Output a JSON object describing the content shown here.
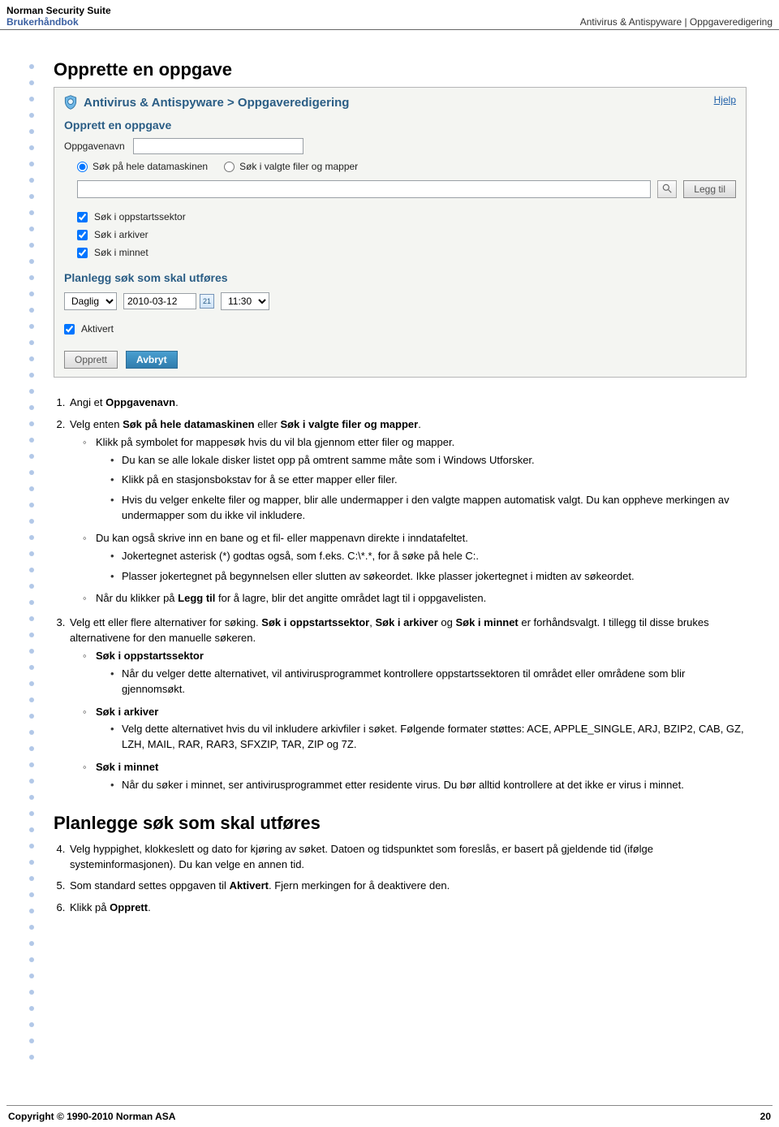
{
  "header": {
    "product": "Norman Security Suite",
    "doc": "Brukerhåndbok",
    "breadcrumb": "Antivirus & Antispyware | Oppgaveredigering"
  },
  "section1_title": "Opprette en oppgave",
  "app": {
    "crumb": "Antivirus & Antispyware > Oppgaveredigering",
    "help": "Hjelp",
    "create_title": "Opprett en oppgave",
    "taskname_label": "Oppgavenavn",
    "taskname_value": "",
    "radio_whole": "Søk på hele datamaskinen",
    "radio_selected": "Søk i valgte filer og mapper",
    "path_value": "",
    "add_btn": "Legg til",
    "chk_boot": "Søk i oppstartssektor",
    "chk_arch": "Søk i arkiver",
    "chk_mem": "Søk i minnet",
    "plan_title": "Planlegg søk som skal utføres",
    "freq": "Daglig",
    "date": "2010-03-12",
    "cal_abbrev": "21",
    "time": "11:30",
    "chk_enabled": "Aktivert",
    "btn_create": "Opprett",
    "btn_cancel": "Avbryt"
  },
  "doc": {
    "s1": "Angi et ",
    "s1b": "Oppgavenavn",
    "s1e": ".",
    "s2a": "Velg enten ",
    "s2b1": "Søk på hele datamaskinen",
    "s2m": " eller ",
    "s2b2": "Søk i valgte filer og mapper",
    "s2e": ".",
    "c1": "Klikk på symbolet for mappesøk hvis du vil bla gjennom etter filer og mapper.",
    "c1_b1": "Du kan se alle lokale disker listet opp på omtrent samme måte som i Windows Utforsker.",
    "c1_b2": "Klikk på en stasjonsbokstav for å se etter mapper eller filer.",
    "c1_b3": "Hvis du velger enkelte filer og mapper, blir alle undermapper i den valgte mappen automatisk valgt. Du kan oppheve merkingen av undermapper som du ikke vil inkludere.",
    "c2": "Du kan også skrive inn en bane og et fil- eller mappenavn direkte i inndatafeltet.",
    "c2_b1": "Jokertegnet asterisk (*) godtas også, som f.eks. C:\\*.*, for å søke på hele C:.",
    "c2_b2": "Plasser jokertegnet på begynnelsen eller slutten av søkeordet. Ikke plasser jokertegnet i midten av søkeordet.",
    "c3a": "Når du klikker på ",
    "c3b": "Legg til",
    "c3c": " for å lagre, blir det angitte området lagt til i oppgavelisten.",
    "s3a": "Velg ett eller flere alternativer for søking. ",
    "s3b1": "Søk i oppstartssektor",
    "s3m1": ", ",
    "s3b2": "Søk i arkiver",
    "s3m2": " og ",
    "s3b3": "Søk i minnet",
    "s3e": " er forhåndsvalgt. I tillegg til disse brukes alternativene for den manuelle søkeren.",
    "opt_boot_t": "Søk i oppstartssektor",
    "opt_boot_d": "Når du velger dette alternativet, vil antivirusprogrammet kontrollere oppstartssektoren til området eller områdene som blir gjennomsøkt.",
    "opt_arch_t": "Søk i arkiver",
    "opt_arch_d": "Velg dette alternativet hvis du vil inkludere arkivfiler i søket. Følgende formater støttes: ACE, APPLE_SINGLE, ARJ, BZIP2, CAB, GZ, LZH, MAIL, RAR, RAR3, SFXZIP, TAR, ZIP og 7Z.",
    "opt_mem_t": "Søk i minnet",
    "opt_mem_d": "Når du søker i minnet, ser antivirusprogrammet etter residente virus. Du bør alltid kontrollere at det ikke er virus i minnet.",
    "section2_title": "Planlegge søk som skal utføres",
    "s4": "Velg hyppighet, klokkeslett og dato for kjøring av søket. Datoen og tidspunktet som foreslås, er basert på gjeldende tid (ifølge systeminformasjonen). Du kan velge en annen tid.",
    "s5a": "Som standard settes oppgaven til ",
    "s5b": "Aktivert",
    "s5c": ". Fjern merkingen for å deaktivere den.",
    "s6a": "Klikk på ",
    "s6b": "Opprett",
    "s6c": "."
  },
  "footer": {
    "copyright": "Copyright © 1990-2010 Norman ASA",
    "page": "20"
  }
}
